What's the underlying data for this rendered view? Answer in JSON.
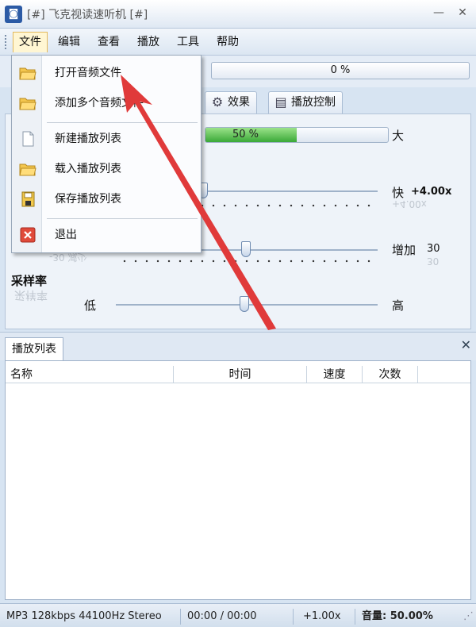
{
  "window": {
    "title": "[#] 飞克视读速听机 [#]",
    "icon_name": "app-logo-icon"
  },
  "menubar": {
    "items": [
      "文件",
      "编辑",
      "查看",
      "播放",
      "工具",
      "帮助"
    ],
    "active_index": 0
  },
  "toolbar": {
    "progress_text": "0 %"
  },
  "tabs": [
    {
      "label": "效果",
      "icon": "gear-icon"
    },
    {
      "label": "播放控制",
      "icon": "playback-control-icon"
    }
  ],
  "main": {
    "volume": {
      "percent_text": "50 %",
      "value_percent": 50,
      "max_label": "大"
    },
    "speed": {
      "max_label": "快",
      "value_text": "+4.00x"
    },
    "gain": {
      "min_reflection": "-30  减少",
      "max_label": "增加",
      "value_text": "30"
    },
    "sample_rate": {
      "title": "采样率",
      "min_label": "低",
      "max_label": "高"
    }
  },
  "dropdown": {
    "items": [
      {
        "label": "打开音频文件",
        "icon": "open-folder-icon"
      },
      {
        "label": "添加多个音频文件",
        "icon": "add-folder-icon"
      },
      {
        "label": "新建播放列表",
        "icon": "new-file-icon"
      },
      {
        "label": "载入播放列表",
        "icon": "load-folder-icon"
      },
      {
        "label": "保存播放列表",
        "icon": "save-disk-icon"
      },
      {
        "label": "退出",
        "icon": "exit-icon"
      }
    ]
  },
  "playlist": {
    "tab_label": "播放列表",
    "columns": [
      "名称",
      "时间",
      "速度",
      "次数"
    ]
  },
  "statusbar": {
    "format": "MP3 128kbps 44100Hz Stereo",
    "time": "00:00 / 00:00",
    "speed": "+1.00x",
    "volume": "音量: 50.00%"
  },
  "colors": {
    "accent_red": "#e03a3a",
    "level_green": "#3aa838",
    "menu_highlight": "#fff6d3"
  }
}
